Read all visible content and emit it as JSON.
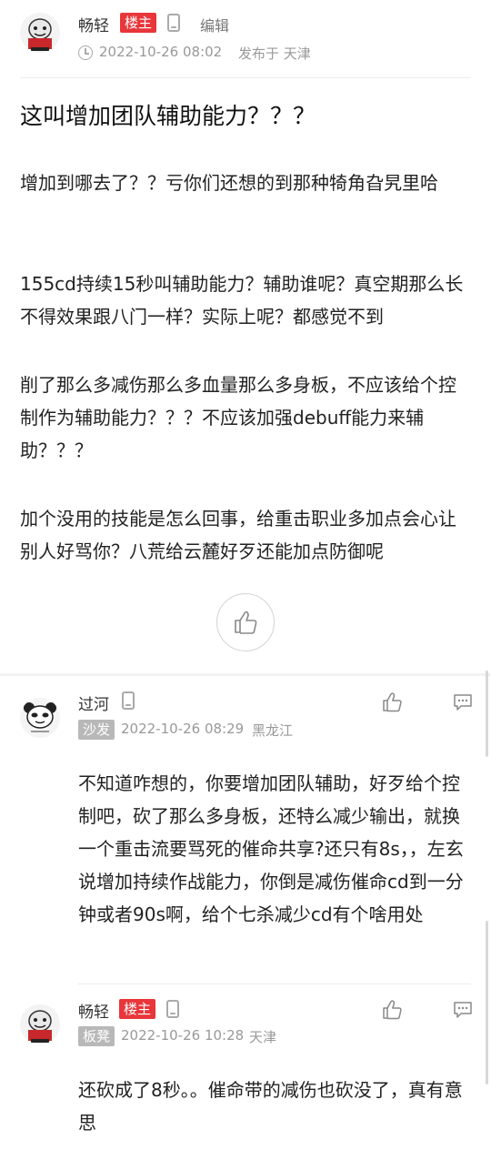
{
  "post": {
    "author": "畅轻",
    "op_badge": "楼主",
    "edit": "编辑",
    "timestamp": "2022-10-26 08:02",
    "location": "发布于 天津",
    "title": "这叫增加团队辅助能力？？？",
    "paragraphs": [
      "增加到哪去了？？亏你们还想的到那种犄角旮旯里哈",
      "155cd持续15秒叫辅助能力？辅助谁呢？真空期那么长不得效果跟八门一样？实际上呢？都感觉不到",
      "削了那么多减伤那么多血量那么多身板，不应该给个控制作为辅助能力？？？不应该加强debuff能力来辅助？？？",
      "加个没用的技能是怎么回事，给重击职业多加点会心让别人好骂你？八荒给云麓好歹还能加点防御呢"
    ]
  },
  "replies": [
    {
      "author": "过河",
      "floor": "沙发",
      "timestamp": "2022-10-26 08:29",
      "location": "黑龙江",
      "text": "不知道咋想的，你要增加团队辅助，好歹给个控制吧，砍了那么多身板，还特么减少输出，就换一个重击流要骂死的催命共享?还只有8s，，左玄说增加持续作战能力，你倒是减伤催命cd到一分钟或者90s啊，给个七杀减少cd有个啥用处"
    },
    {
      "author": "畅轻",
      "op_badge": "楼主",
      "floor": "板凳",
      "timestamp": "2022-10-26 10:28",
      "location": "天津",
      "text": "还砍成了8秒。。催命带的减伤也砍没了，真有意思"
    }
  ],
  "colors": {
    "op_badge": "#e8363a",
    "floor_badge": "#b8b8b8",
    "meta_text": "#999999"
  },
  "icons": [
    "clock-icon",
    "phone-icon",
    "thumbs-up-icon",
    "comment-icon"
  ]
}
